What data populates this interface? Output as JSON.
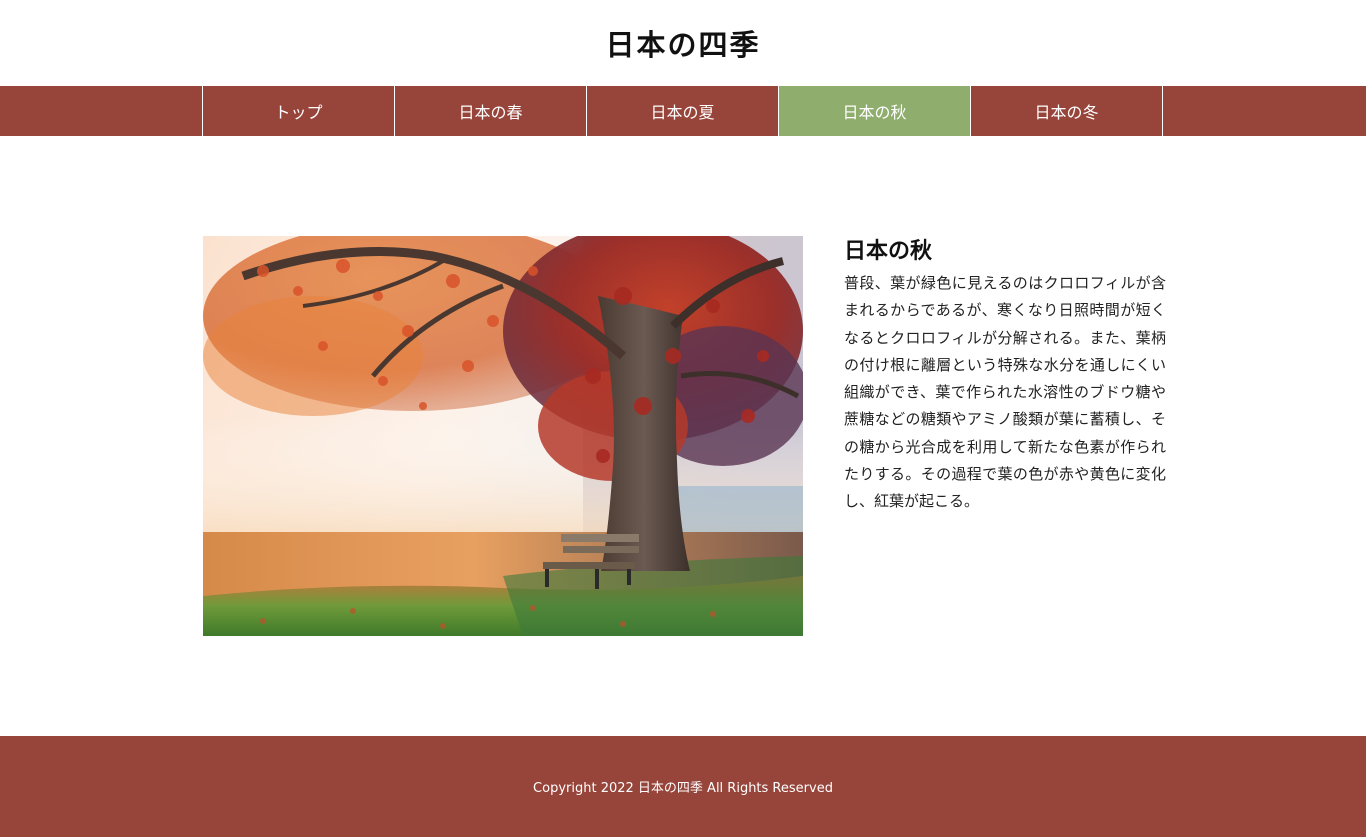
{
  "header": {
    "title": "日本の四季"
  },
  "nav": {
    "items": [
      {
        "label": "トップ"
      },
      {
        "label": "日本の春"
      },
      {
        "label": "日本の夏"
      },
      {
        "label": "日本の秋"
      },
      {
        "label": "日本の冬"
      }
    ],
    "active_index": 3
  },
  "article": {
    "title": "日本の秋",
    "body": "普段、葉が緑色に見えるのはクロロフィルが含まれるからであるが、寒くなり日照時間が短くなるとクロロフィルが分解される。また、葉柄の付け根に離層という特殊な水分を通しにくい組織ができ、葉で作られた水溶性のブドウ糖や蔗糖などの糖類やアミノ酸類が葉に蓄積し、その糖から光合成を利用して新たな色素が作られたりする。その過程で葉の色が赤や黄色に変化し、紅葉が起こる。"
  },
  "footer": {
    "copyright": "Copyright 2022 日本の四季 All Rights Reserved"
  },
  "colors": {
    "brand": "#97443a",
    "nav_active": "#8fae6e",
    "text": "#222222",
    "background": "#ffffff"
  }
}
